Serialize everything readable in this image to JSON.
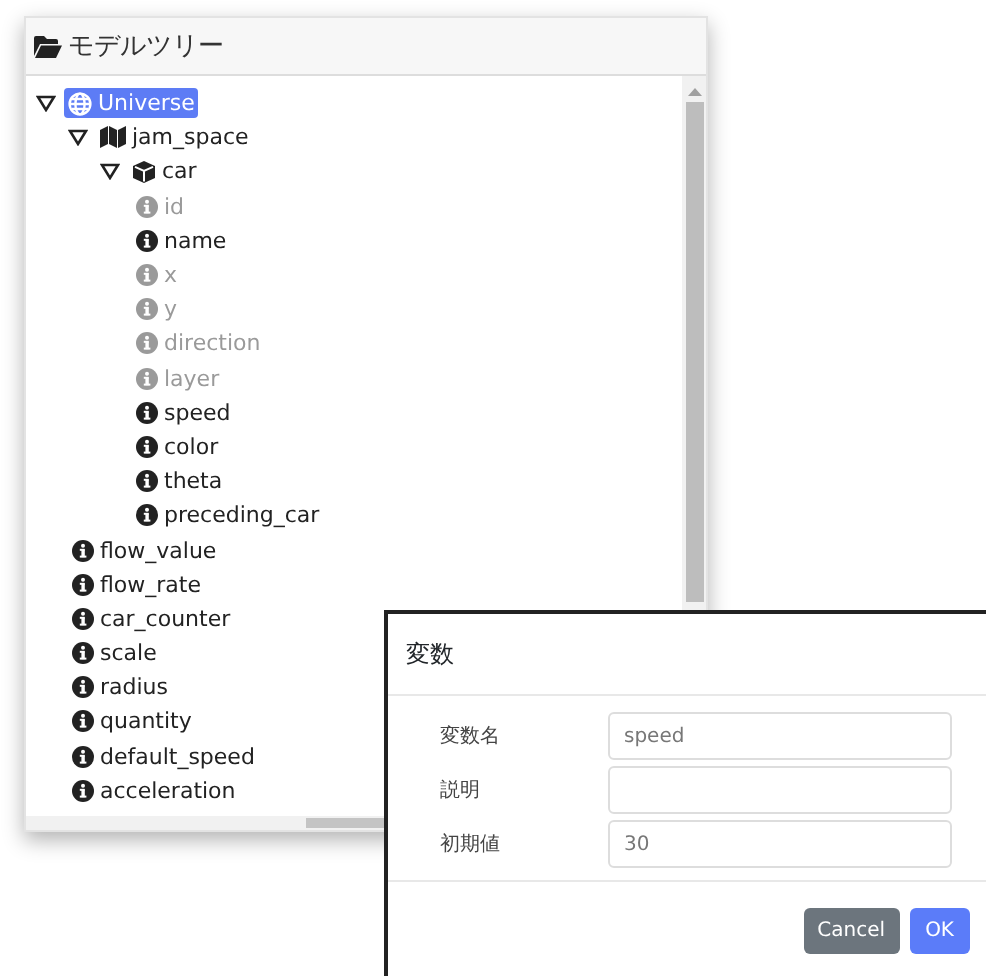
{
  "panel": {
    "title": "モデルツリー"
  },
  "tree": [
    {
      "label": "Universe",
      "kind": "universe",
      "selected": true,
      "expanded": true,
      "disabled": false,
      "children": [
        {
          "label": "jam_space",
          "kind": "space",
          "selected": false,
          "expanded": true,
          "disabled": false,
          "children": [
            {
              "label": "car",
              "kind": "agent",
              "selected": false,
              "expanded": true,
              "disabled": false,
              "children": [
                {
                  "label": "id",
                  "kind": "variable",
                  "selected": false,
                  "disabled": true
                },
                {
                  "label": "name",
                  "kind": "variable",
                  "selected": false,
                  "disabled": false
                },
                {
                  "label": "x",
                  "kind": "variable",
                  "selected": false,
                  "disabled": true
                },
                {
                  "label": "y",
                  "kind": "variable",
                  "selected": false,
                  "disabled": true
                },
                {
                  "label": "direction",
                  "kind": "variable",
                  "selected": false,
                  "disabled": true
                },
                {
                  "label": "layer",
                  "kind": "variable",
                  "selected": false,
                  "disabled": true
                },
                {
                  "label": "speed",
                  "kind": "variable",
                  "selected": false,
                  "disabled": false
                },
                {
                  "label": "color",
                  "kind": "variable",
                  "selected": false,
                  "disabled": false
                },
                {
                  "label": "theta",
                  "kind": "variable",
                  "selected": false,
                  "disabled": false
                },
                {
                  "label": "preceding_car",
                  "kind": "variable",
                  "selected": false,
                  "disabled": false
                }
              ]
            }
          ]
        },
        {
          "label": "flow_value",
          "kind": "variable",
          "selected": false,
          "disabled": false
        },
        {
          "label": "flow_rate",
          "kind": "variable",
          "selected": false,
          "disabled": false
        },
        {
          "label": "car_counter",
          "kind": "variable",
          "selected": false,
          "disabled": false
        },
        {
          "label": "scale",
          "kind": "variable",
          "selected": false,
          "disabled": false
        },
        {
          "label": "radius",
          "kind": "variable",
          "selected": false,
          "disabled": false
        },
        {
          "label": "quantity",
          "kind": "variable",
          "selected": false,
          "disabled": false
        },
        {
          "label": "default_speed",
          "kind": "variable",
          "selected": false,
          "disabled": false
        },
        {
          "label": "acceleration",
          "kind": "variable",
          "selected": false,
          "disabled": false
        }
      ]
    }
  ],
  "dialog": {
    "title": "変数",
    "fields": [
      {
        "label": "変数名",
        "value": "speed"
      },
      {
        "label": "説明"
      },
      {
        "label": "初期値",
        "value": "30"
      }
    ],
    "buttons": [
      {
        "label": "Cancel",
        "kind": "secondary"
      },
      {
        "label": "OK",
        "kind": "primary"
      }
    ]
  }
}
